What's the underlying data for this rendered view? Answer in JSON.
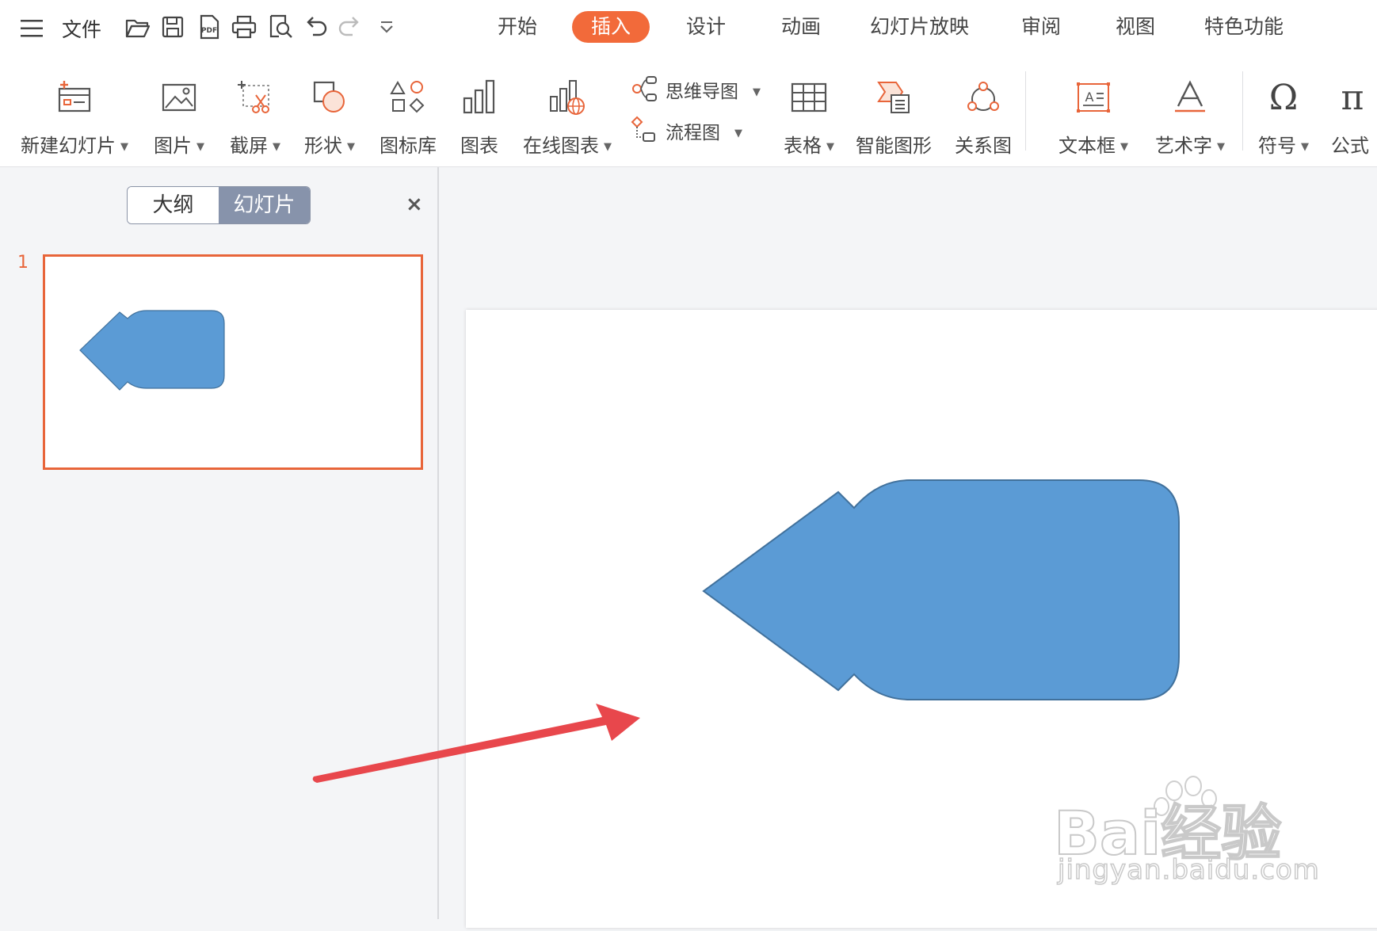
{
  "menubar": {
    "file_label": "文件",
    "tabs": [
      {
        "label": "开始",
        "active": false
      },
      {
        "label": "插入",
        "active": true
      },
      {
        "label": "设计",
        "active": false
      },
      {
        "label": "动画",
        "active": false
      },
      {
        "label": "幻灯片放映",
        "active": false
      },
      {
        "label": "审阅",
        "active": false
      },
      {
        "label": "视图",
        "active": false
      },
      {
        "label": "特色功能",
        "active": false
      }
    ],
    "quick_access_icons": [
      "open-folder-icon",
      "save-icon",
      "export-pdf-icon",
      "print-icon",
      "print-preview-icon",
      "undo-icon",
      "redo-icon",
      "customize-dropdown-icon"
    ]
  },
  "ribbon": {
    "new_slide": "新建幻灯片",
    "picture": "图片",
    "screenshot": "截屏",
    "shape": "形状",
    "icon_library": "图标库",
    "chart": "图表",
    "online_chart": "在线图表",
    "mind_map": "思维导图",
    "flowchart": "流程图",
    "table": "表格",
    "smart_art": "智能图形",
    "relation_chart": "关系图",
    "text_box": "文本框",
    "word_art": "艺术字",
    "symbol": "符号",
    "formula": "公式"
  },
  "left_panel": {
    "outline_tab": "大纲",
    "slides_tab": "幻灯片",
    "close_symbol": "×",
    "slide_number": "1"
  },
  "slide": {
    "shape_color": "#5b9bd5",
    "shape_outline": "#41719c",
    "annotation_arrow_color": "#e8474c"
  },
  "watermark": {
    "logo_text": "Bai经验",
    "url": "jingyan.baidu.com"
  },
  "colors": {
    "accent": "#f26a3a",
    "segment_active": "#8793ab",
    "icon_orange": "#e8653a"
  }
}
